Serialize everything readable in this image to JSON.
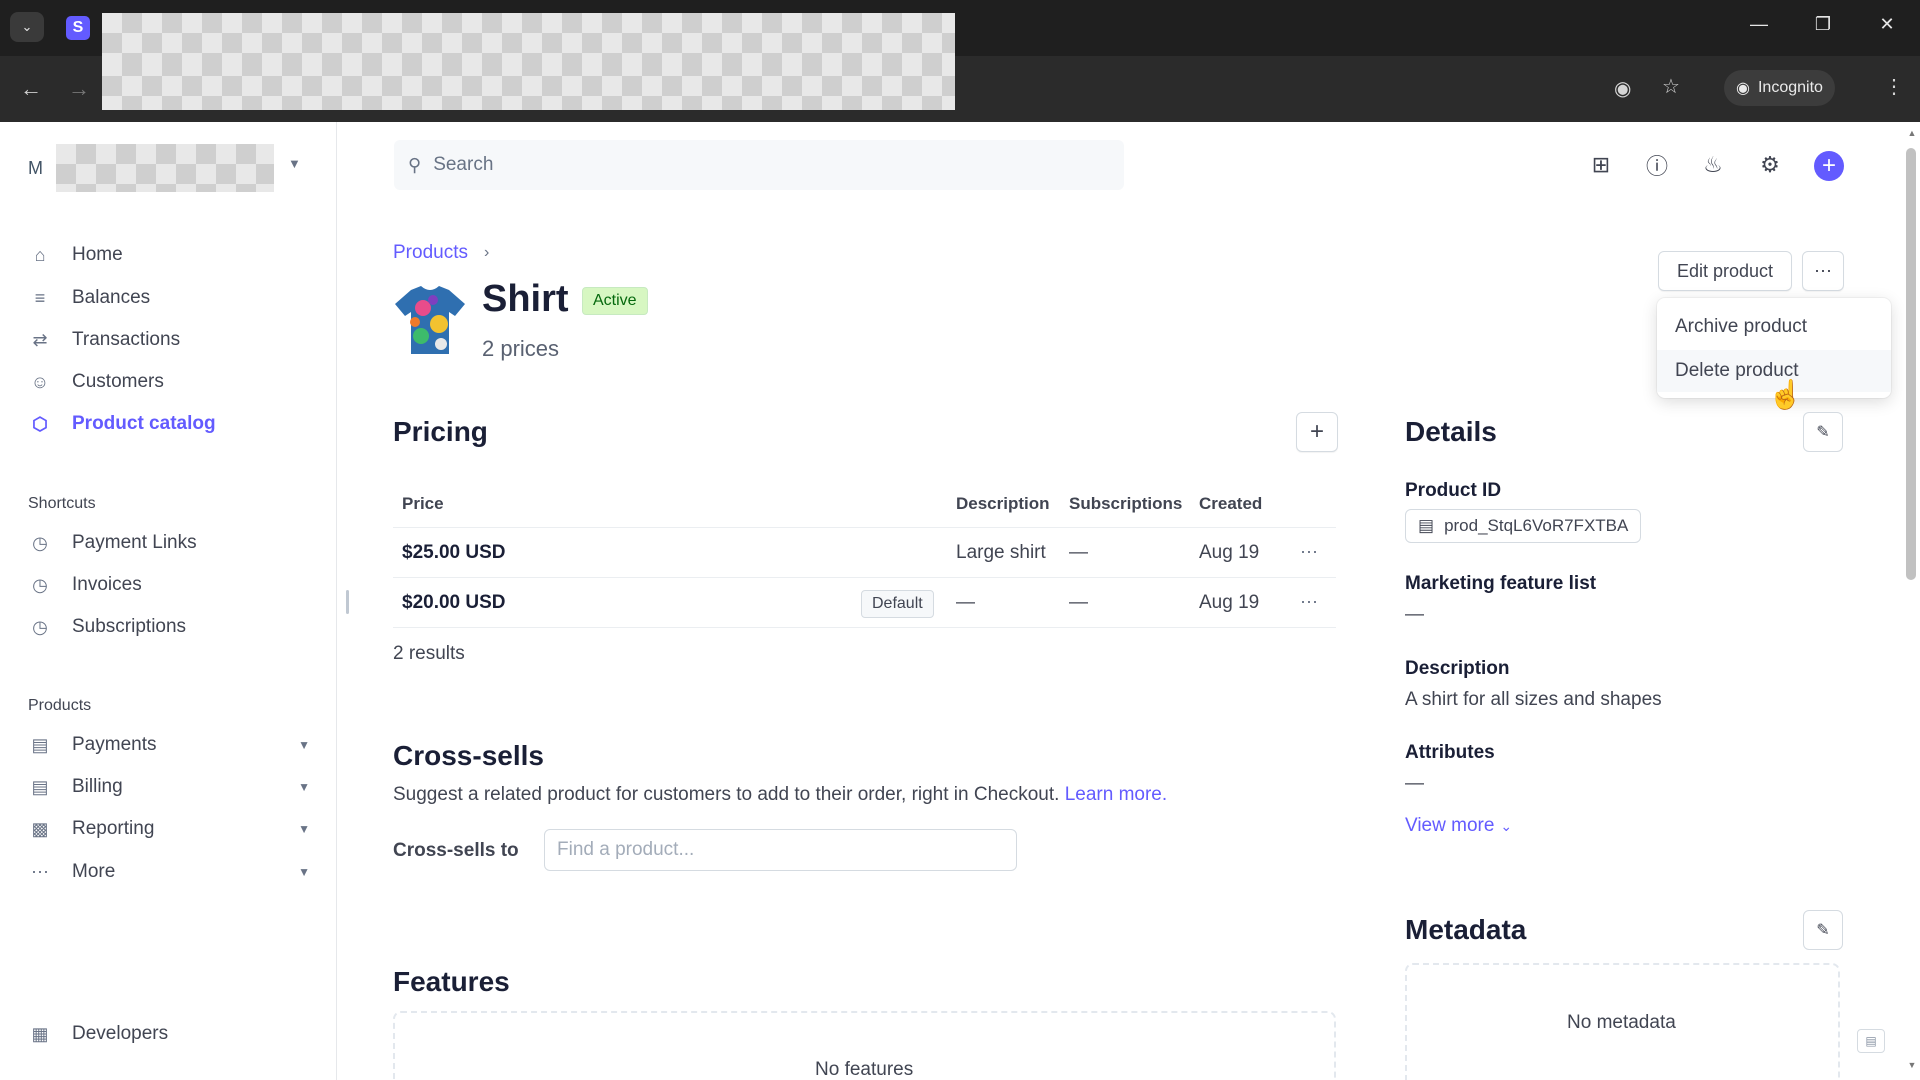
{
  "browser": {
    "incognito_label": "Incognito"
  },
  "account": {
    "initial": "M"
  },
  "sidebar": {
    "main_items": [
      {
        "label": "Home",
        "icon": "home-icon"
      },
      {
        "label": "Balances",
        "icon": "balances-icon"
      },
      {
        "label": "Transactions",
        "icon": "transactions-icon"
      },
      {
        "label": "Customers",
        "icon": "customers-icon"
      },
      {
        "label": "Product catalog",
        "icon": "product-catalog-icon",
        "active": true
      }
    ],
    "shortcuts_title": "Shortcuts",
    "shortcuts": [
      {
        "label": "Payment Links",
        "icon": "clock-icon"
      },
      {
        "label": "Invoices",
        "icon": "clock-icon"
      },
      {
        "label": "Subscriptions",
        "icon": "clock-icon"
      }
    ],
    "products_title": "Products",
    "products": [
      {
        "label": "Payments",
        "icon": "payments-icon"
      },
      {
        "label": "Billing",
        "icon": "billing-icon"
      },
      {
        "label": "Reporting",
        "icon": "reporting-icon"
      },
      {
        "label": "More",
        "icon": "more-icon"
      }
    ],
    "developers": {
      "label": "Developers",
      "icon": "terminal-icon"
    }
  },
  "search": {
    "placeholder": "Search"
  },
  "breadcrumb": {
    "parent": "Products"
  },
  "product": {
    "name": "Shirt",
    "status": "Active",
    "price_count": "2 prices"
  },
  "actions": {
    "edit_label": "Edit product",
    "menu": [
      "Archive product",
      "Delete product"
    ]
  },
  "pricing": {
    "title": "Pricing",
    "columns": [
      "Price",
      "Description",
      "Subscriptions",
      "Created"
    ],
    "rows": [
      {
        "price": "$25.00 USD",
        "badge": "",
        "description": "Large shirt",
        "subscriptions": "—",
        "created": "Aug 19"
      },
      {
        "price": "$20.00 USD",
        "badge": "Default",
        "description": "—",
        "subscriptions": "—",
        "created": "Aug 19"
      }
    ],
    "results": "2 results"
  },
  "cross_sells": {
    "title": "Cross-sells",
    "description": "Suggest a related product for customers to add to their order, right in Checkout.",
    "link": "Learn more.",
    "label": "Cross-sells to",
    "placeholder": "Find a product..."
  },
  "features": {
    "title": "Features",
    "empty": "No features"
  },
  "details": {
    "title": "Details",
    "product_id_label": "Product ID",
    "product_id": "prod_StqL6VoR7FXTBA",
    "marketing_label": "Marketing feature list",
    "marketing_value": "—",
    "description_label": "Description",
    "description_value": "A shirt for all sizes and shapes",
    "attributes_label": "Attributes",
    "attributes_value": "—",
    "view_more": "View more"
  },
  "metadata": {
    "title": "Metadata",
    "empty": "No metadata"
  },
  "colors": {
    "accent": "#635bff",
    "active_badge_bg": "#d7f7c2",
    "active_badge_text": "#05690d"
  }
}
